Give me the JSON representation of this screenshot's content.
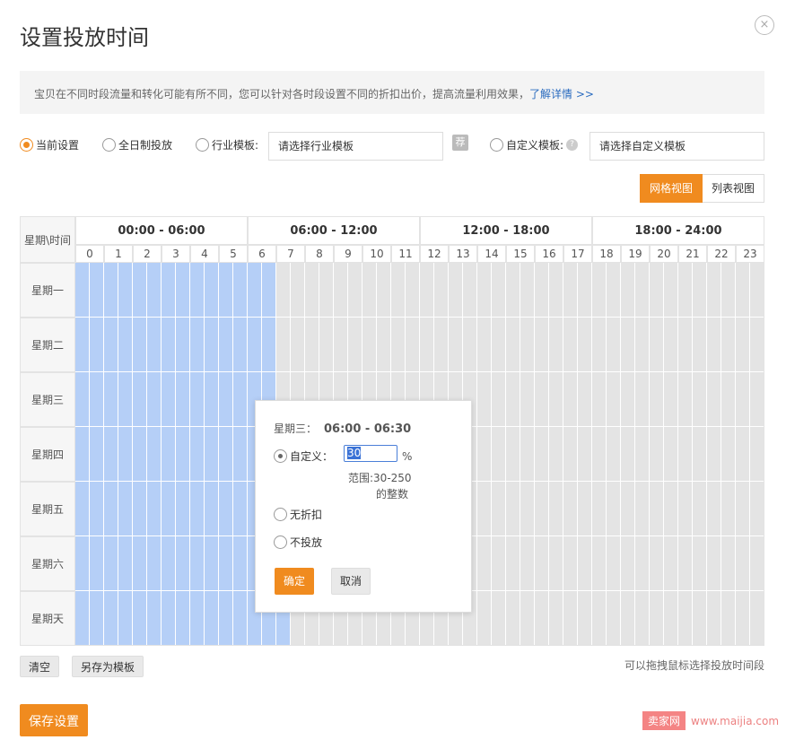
{
  "dialog": {
    "title": "设置投放时间",
    "close_glyph": "×"
  },
  "notice": {
    "text": "宝贝在不同时段流量和转化可能有所不同，您可以针对各时段设置不同的折扣出价，提高流量利用效果，",
    "link": "了解详情 >>"
  },
  "options": {
    "current": "当前设置",
    "all_day": "全日制投放",
    "industry": "行业模板:",
    "industry_placeholder": "请选择行业模板",
    "recommend_badge": "荐",
    "custom": "自定义模板:",
    "custom_placeholder": "请选择自定义模板",
    "selected": "current",
    "help_icon": "question-circle-icon"
  },
  "view": {
    "grid_label": "网格视图",
    "list_label": "列表视图",
    "active": "grid"
  },
  "grid": {
    "corner_label": "星期\\时间",
    "ranges": [
      "00:00 - 06:00",
      "06:00 - 12:00",
      "12:00 - 18:00",
      "18:00 - 24:00"
    ],
    "hours": [
      "0",
      "1",
      "2",
      "3",
      "4",
      "5",
      "6",
      "7",
      "8",
      "9",
      "10",
      "11",
      "12",
      "13",
      "14",
      "15",
      "16",
      "17",
      "18",
      "19",
      "20",
      "21",
      "22",
      "23"
    ],
    "days": [
      "星期一",
      "星期二",
      "星期三",
      "星期四",
      "星期五",
      "星期六",
      "星期天"
    ],
    "selected_half_hours_per_day": [
      14,
      14,
      14,
      14,
      14,
      14,
      15
    ],
    "colors": {
      "selected": "#b5cff7",
      "unselected": "#e4e4e4"
    }
  },
  "popup": {
    "day": "星期三：",
    "time": "06:00 - 06:30",
    "custom_label": "自定义：",
    "custom_value": "30",
    "unit": "%",
    "range_line1": "范围:30-250",
    "range_line2": "的整数",
    "no_discount": "无折扣",
    "no_delivery": "不投放",
    "confirm": "确定",
    "cancel": "取消"
  },
  "footer": {
    "clear": "清空",
    "save_as_template": "另存为模板",
    "hint": "可以拖拽鼠标选择投放时间段",
    "save": "保存设置"
  },
  "watermark": {
    "logo": "卖家网",
    "url": "www.maijia.com"
  },
  "colors": {
    "accent": "#f08b1f",
    "link": "#2a6bbf"
  }
}
